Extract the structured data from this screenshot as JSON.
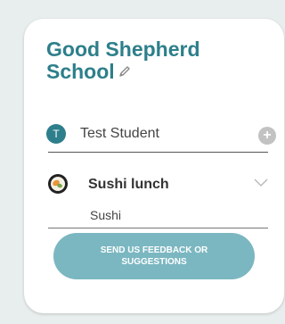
{
  "school": {
    "name": "Good Shepherd School",
    "edit_icon": "pencil-icon"
  },
  "student": {
    "avatar_initial": "T",
    "name": "Test Student",
    "add_icon": "plus-icon"
  },
  "lunch": {
    "icon": "sushi-icon",
    "title": "Sushi lunch",
    "subtitle": "Sushi",
    "expand_icon": "chevron-down-icon"
  },
  "feedback": {
    "label": "SEND US FEEDBACK OR SUGGESTIONS"
  },
  "colors": {
    "accent": "#2d7f8b",
    "button": "#7bb7c1",
    "background": "#e8eeed"
  }
}
